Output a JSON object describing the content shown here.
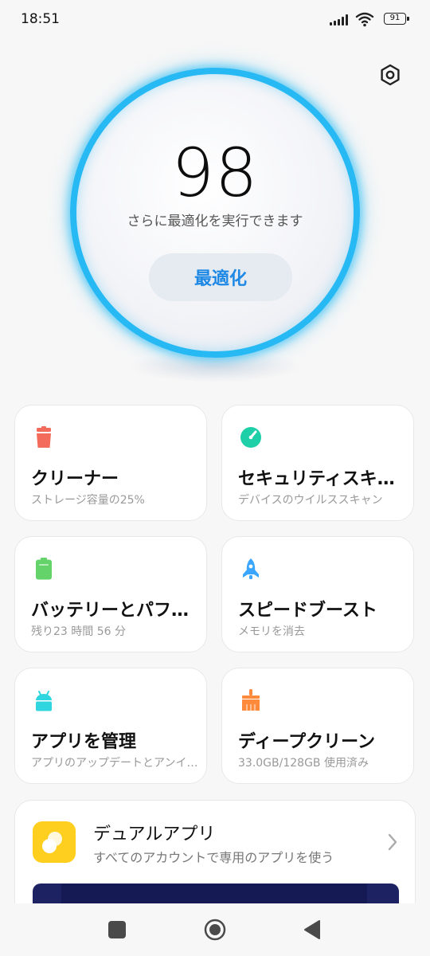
{
  "status_bar": {
    "time": "18:51",
    "battery": "91"
  },
  "score_panel": {
    "score": "98",
    "hint": "さらに最適化を実行できます",
    "button_label": "最適化",
    "accent_color": "#27b9f3"
  },
  "cards": [
    {
      "title": "クリーナー",
      "subtitle": "ストレージ容量の25%",
      "icon": "trash-icon",
      "color": "#f26b5b"
    },
    {
      "title": "セキュリティスキャン",
      "subtitle": "デバイスのウイルススキャン",
      "icon": "shield-scan-icon",
      "color": "#1fcfa8"
    },
    {
      "title": "バッテリーとパフォーマンス",
      "subtitle": "残り23 時間 56 分",
      "icon": "battery-icon",
      "color": "#63d36a"
    },
    {
      "title": "スピードブースト",
      "subtitle": "メモリを消去",
      "icon": "rocket-icon",
      "color": "#3aa6ff"
    },
    {
      "title": "アプリを管理",
      "subtitle": "アプリのアップデートとアンインストール",
      "icon": "android-icon",
      "color": "#2fd6e0"
    },
    {
      "title": "ディープクリーン",
      "subtitle": "33.0GB/128GB 使用済み",
      "icon": "brush-icon",
      "color": "#ff8a3c"
    }
  ],
  "dual_app": {
    "title": "デュアルアプリ",
    "subtitle": "すべてのアカウントで専用のアプリを使う",
    "icon": "dual-app-icon",
    "color": "#ffcf1f"
  }
}
